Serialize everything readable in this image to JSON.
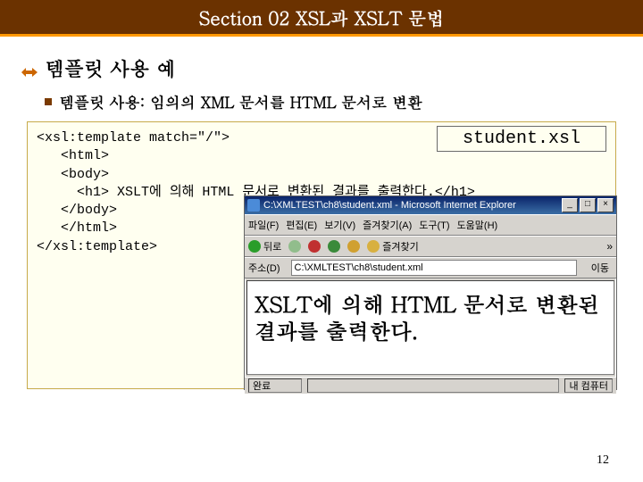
{
  "section": {
    "title": "Section 02 XSL과 XSLT 문법"
  },
  "h2": {
    "text": "템플릿 사용 예"
  },
  "h3": {
    "text": "템플릿 사용: 임의의 XML 문서를 HTML 문서로 변환"
  },
  "code": {
    "filename": "student.xsl",
    "lines": "<xsl:template match=\"/\">\n   <html>\n   <body>\n     <h1> XSLT에 의해 HTML 문서로 변환된 결과를 출력한다.</h1>\n   </body>\n   </html>\n</xsl:template>"
  },
  "browser": {
    "title": "C:\\XMLTEST\\ch8\\student.xml - Microsoft Internet Explorer",
    "menus": [
      "파일(F)",
      "편집(E)",
      "보기(V)",
      "즐겨찾기(A)",
      "도구(T)",
      "도움말(H)"
    ],
    "toolbar": {
      "back": "뒤로",
      "fav": "즐겨찾기"
    },
    "addr": {
      "label": "주소(D)",
      "value": "C:\\XMLTEST\\ch8\\student.xml",
      "go": "이동"
    },
    "page_h1": "XSLT에 의해 HTML 문서로 변환된 결과를 출력한다.",
    "status": {
      "done": "완료",
      "zone": "내 컴퓨터"
    },
    "winbtns": {
      "min": "_",
      "max": "□",
      "close": "×"
    },
    "chev": "»"
  },
  "page_number": "12"
}
